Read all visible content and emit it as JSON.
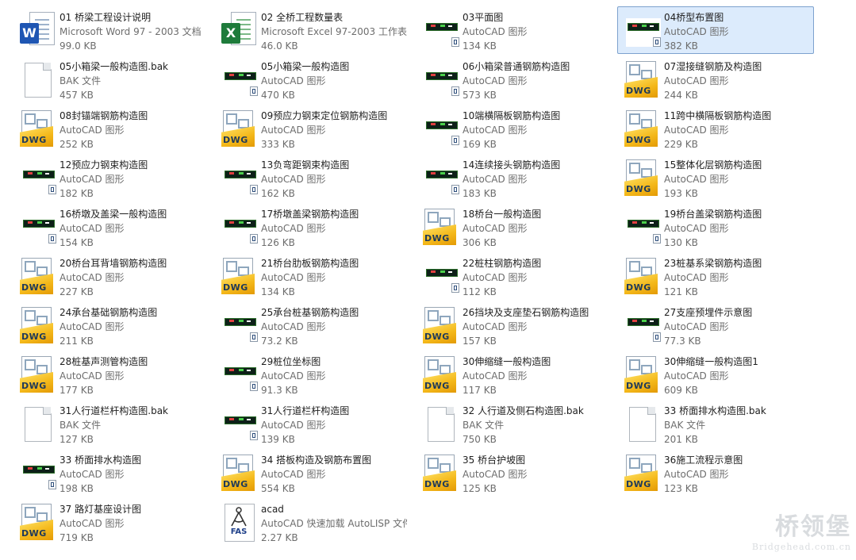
{
  "watermark": {
    "chinese": "桥领堡",
    "domain": "Bridgehead.com.cn"
  },
  "selected_index": 3,
  "files": [
    {
      "name": "01 桥梁工程设计说明",
      "type": "Microsoft Word 97 - 2003 文档",
      "size": "99.0 KB",
      "icon": "word"
    },
    {
      "name": "02 全桥工程数量表",
      "type": "Microsoft Excel 97-2003 工作表",
      "size": "46.0 KB",
      "icon": "excel"
    },
    {
      "name": "03平面图",
      "type": "AutoCAD 图形",
      "size": "134 KB",
      "icon": "thumb"
    },
    {
      "name": "04桥型布置图",
      "type": "AutoCAD 图形",
      "size": "382 KB",
      "icon": "thumb"
    },
    {
      "name": "05小箱梁一般构造图.bak",
      "type": "BAK 文件",
      "size": "457 KB",
      "icon": "bak"
    },
    {
      "name": "05小箱梁一般构造图",
      "type": "AutoCAD 图形",
      "size": "470 KB",
      "icon": "thumb"
    },
    {
      "name": "06小箱梁普通钢筋构造图",
      "type": "AutoCAD 图形",
      "size": "573 KB",
      "icon": "thumb"
    },
    {
      "name": "07湿接缝钢筋及构造图",
      "type": "AutoCAD 图形",
      "size": "244 KB",
      "icon": "dwg"
    },
    {
      "name": "08封锚端钢筋构造图",
      "type": "AutoCAD 图形",
      "size": "252 KB",
      "icon": "dwg"
    },
    {
      "name": "09预应力钢束定位钢筋构造图",
      "type": "AutoCAD 图形",
      "size": "333 KB",
      "icon": "dwg"
    },
    {
      "name": "10端横隔板钢筋构造图",
      "type": "AutoCAD 图形",
      "size": "169 KB",
      "icon": "thumb"
    },
    {
      "name": "11跨中横隔板钢筋构造图",
      "type": "AutoCAD 图形",
      "size": "229 KB",
      "icon": "dwg"
    },
    {
      "name": "12预应力钢束构造图",
      "type": "AutoCAD 图形",
      "size": "182 KB",
      "icon": "thumb"
    },
    {
      "name": "13负弯距钢束构造图",
      "type": "AutoCAD 图形",
      "size": "162 KB",
      "icon": "thumb"
    },
    {
      "name": "14连续接头钢筋构造图",
      "type": "AutoCAD 图形",
      "size": "183 KB",
      "icon": "thumb"
    },
    {
      "name": "15整体化层钢筋构造图",
      "type": "AutoCAD 图形",
      "size": "193 KB",
      "icon": "dwg"
    },
    {
      "name": "16桥墩及盖梁一般构造图",
      "type": "AutoCAD 图形",
      "size": "154 KB",
      "icon": "thumb"
    },
    {
      "name": "17桥墩盖梁钢筋构造图",
      "type": "AutoCAD 图形",
      "size": "126 KB",
      "icon": "thumb"
    },
    {
      "name": "18桥台一般构造图",
      "type": "AutoCAD 图形",
      "size": "306 KB",
      "icon": "dwg"
    },
    {
      "name": "19桥台盖梁钢筋构造图",
      "type": "AutoCAD 图形",
      "size": "130 KB",
      "icon": "thumb"
    },
    {
      "name": "20桥台耳背墙钢筋构造图",
      "type": "AutoCAD 图形",
      "size": "227 KB",
      "icon": "dwg"
    },
    {
      "name": "21桥台肋板钢筋构造图",
      "type": "AutoCAD 图形",
      "size": "134 KB",
      "icon": "dwg"
    },
    {
      "name": "22桩柱钢筋构造图",
      "type": "AutoCAD 图形",
      "size": "112 KB",
      "icon": "thumb"
    },
    {
      "name": "23桩基系梁钢筋构造图",
      "type": "AutoCAD 图形",
      "size": "121 KB",
      "icon": "dwg"
    },
    {
      "name": "24承台基础钢筋构造图",
      "type": "AutoCAD 图形",
      "size": "211 KB",
      "icon": "dwg"
    },
    {
      "name": "25承台桩基钢筋构造图",
      "type": "AutoCAD 图形",
      "size": "73.2 KB",
      "icon": "thumb"
    },
    {
      "name": "26挡块及支座垫石钢筋构造图",
      "type": "AutoCAD 图形",
      "size": "157 KB",
      "icon": "dwg"
    },
    {
      "name": "27支座预埋件示意图",
      "type": "AutoCAD 图形",
      "size": "77.3 KB",
      "icon": "thumb"
    },
    {
      "name": "28桩基声测管构造图",
      "type": "AutoCAD 图形",
      "size": "177 KB",
      "icon": "dwg"
    },
    {
      "name": "29桩位坐标图",
      "type": "AutoCAD 图形",
      "size": "91.3 KB",
      "icon": "thumb"
    },
    {
      "name": "30伸缩缝一般构造图",
      "type": "AutoCAD 图形",
      "size": "117 KB",
      "icon": "dwg"
    },
    {
      "name": "30伸缩缝一般构造图1",
      "type": "AutoCAD 图形",
      "size": "609 KB",
      "icon": "dwg"
    },
    {
      "name": "31人行道栏杆构造图.bak",
      "type": "BAK 文件",
      "size": "127 KB",
      "icon": "bak"
    },
    {
      "name": "31人行道栏杆构造图",
      "type": "AutoCAD 图形",
      "size": "139 KB",
      "icon": "thumb"
    },
    {
      "name": "32 人行道及侧石构造图.bak",
      "type": "BAK 文件",
      "size": "750 KB",
      "icon": "bak"
    },
    {
      "name": "33 桥面排水构造图.bak",
      "type": "BAK 文件",
      "size": "201 KB",
      "icon": "bak"
    },
    {
      "name": "33 桥面排水构造图",
      "type": "AutoCAD 图形",
      "size": "198 KB",
      "icon": "thumb"
    },
    {
      "name": "34 搭板构造及钢筋布置图",
      "type": "AutoCAD 图形",
      "size": "554 KB",
      "icon": "dwg"
    },
    {
      "name": "35 桥台护坡图",
      "type": "AutoCAD 图形",
      "size": "125 KB",
      "icon": "dwg"
    },
    {
      "name": "36施工流程示意图",
      "type": "AutoCAD 图形",
      "size": "123 KB",
      "icon": "dwg"
    },
    {
      "name": "37 路灯基座设计图",
      "type": "AutoCAD 图形",
      "size": "719 KB",
      "icon": "dwg"
    },
    {
      "name": "acad",
      "type": "AutoCAD 快速加载 AutoLISP 文件",
      "size": "2.27 KB",
      "icon": "fas"
    }
  ]
}
